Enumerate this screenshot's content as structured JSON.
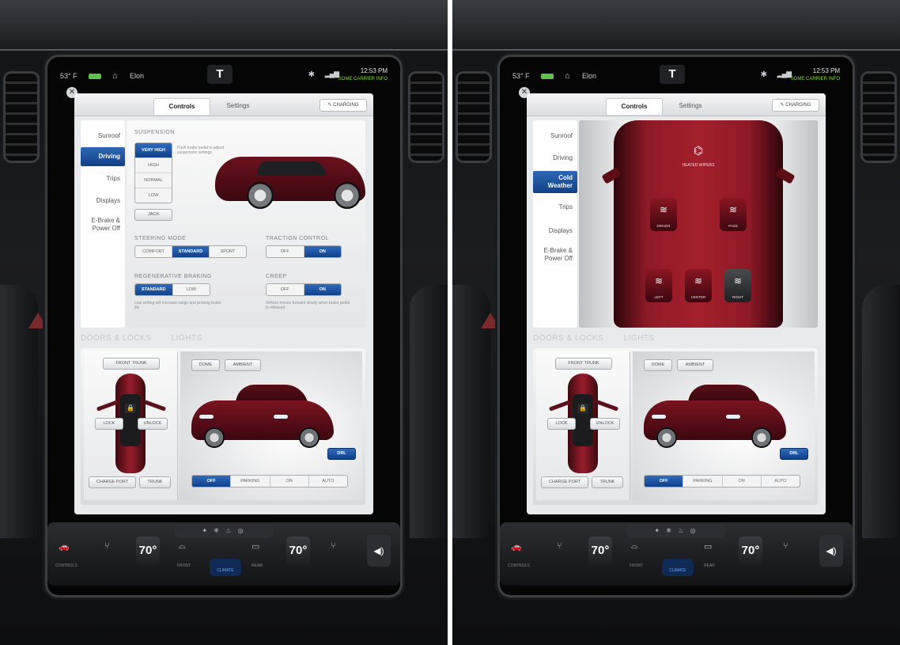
{
  "screens": {
    "left": {
      "status": {
        "temp": "53° F",
        "user": "Elon",
        "time": "12:53 PM",
        "time_sub": "SOME CARRIER INFO"
      },
      "tabs": [
        "Controls",
        "Settings"
      ],
      "user_chip": "✎ CHARGING",
      "nav": [
        "Sunroof",
        "Driving",
        "Trips",
        "Displays",
        "E-Brake & Power Off"
      ],
      "active_nav": "Driving",
      "suspension": {
        "title": "SUSPENSION",
        "options": [
          "VERY HIGH",
          "HIGH",
          "NORMAL",
          "LOW"
        ],
        "selected": "VERY HIGH",
        "note": "Push brake pedal to adjust suspension settings",
        "jack": "JACK"
      },
      "steering": {
        "title": "STEERING MODE",
        "options": [
          "COMFORT",
          "STANDARD",
          "SPORT"
        ],
        "selected": "STANDARD"
      },
      "traction": {
        "title": "TRACTION CONTROL",
        "options": [
          "OFF",
          "ON"
        ],
        "selected": "ON"
      },
      "regen": {
        "title": "REGENERATIVE BRAKING",
        "options": [
          "STANDARD",
          "LOW"
        ],
        "selected": "STANDARD",
        "note": "Low setting will increase range and prolong brake life"
      },
      "creep": {
        "title": "CREEP",
        "options": [
          "OFF",
          "ON"
        ],
        "selected": "ON",
        "note": "Vehicle moves forward slowly when brake pedal is released"
      },
      "lower_titles": {
        "doors": "DOORS & LOCKS",
        "lights": "LIGHTS"
      },
      "doors": {
        "front_trunk": "FRONT TRUNK",
        "lock": "LOCK",
        "unlock": "UNLOCK",
        "charge_port": "CHARGE PORT",
        "trunk": "TRUNK"
      },
      "lights": {
        "dome": "DOME",
        "ambient": "AMBIENT",
        "drl": "DRL",
        "modes": [
          "OFF",
          "PARKING",
          "ON",
          "AUTO"
        ],
        "selected_mode": "OFF"
      }
    },
    "right": {
      "status": {
        "temp": "53° F",
        "user": "Elon",
        "time": "12:53 PM",
        "time_sub": "SOME CARRIER INFO"
      },
      "tabs": [
        "Controls",
        "Settings"
      ],
      "user_chip": "✎ CHARGING",
      "nav": [
        "Sunroof",
        "Driving",
        "Cold Weather",
        "Trips",
        "Displays",
        "E-Brake & Power Off"
      ],
      "active_nav": "Cold Weather",
      "cold_weather": {
        "wiper_label": "HEATED WIPERS",
        "seats": [
          "DRIVER",
          "PASS",
          "LEFT",
          "CENTER",
          "RIGHT"
        ]
      },
      "lower_titles": {
        "doors": "DOORS & LOCKS",
        "lights": "LIGHTS"
      },
      "doors": {
        "front_trunk": "FRONT TRUNK",
        "lock": "LOCK",
        "unlock": "UNLOCK",
        "charge_port": "CHARGE PORT",
        "trunk": "TRUNK"
      },
      "lights": {
        "dome": "DOME",
        "ambient": "AMBIENT",
        "drl": "DRL",
        "modes": [
          "OFF",
          "PARKING",
          "ON",
          "AUTO"
        ],
        "selected_mode": "OFF"
      }
    }
  },
  "climate": {
    "left_temp": "70°",
    "right_temp": "70°",
    "left_label": "CONTROLS",
    "front_label": "FRONT",
    "rear_label": "REAR",
    "auto_label": "CLIMATE",
    "volume_icon": "speaker-icon"
  },
  "colors": {
    "accent": "#1f55a3",
    "car": "#8e1a26"
  }
}
